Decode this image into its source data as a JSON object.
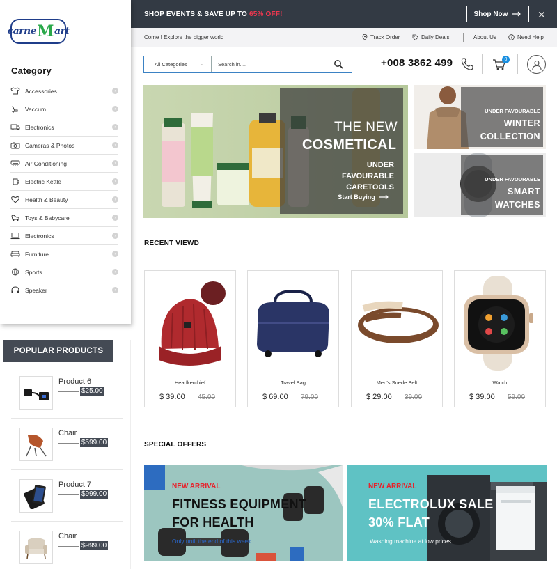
{
  "brand": {
    "logo_text_a": "carne",
    "logo_text_m": "M",
    "logo_text_b": "art"
  },
  "topbar": {
    "promo_text": "SHOP EVENTS & SAVE UP TO ",
    "promo_accent": "65% OFF!",
    "shop_now": "Shop Now"
  },
  "infobar": {
    "welcome": "Come ! Explore the bigger world !",
    "track_order": "Track Order",
    "daily_deals": "Daily Deals",
    "about_us": "About Us",
    "need_help": "Need Help"
  },
  "search": {
    "category": "All Categories",
    "placeholder": "Search in....",
    "phone": "+008 3862 499",
    "cart_count": "0"
  },
  "sidebar": {
    "title": "Category",
    "items": [
      {
        "label": "Accessories",
        "icon": "shirt-icon"
      },
      {
        "label": "Vaccum",
        "icon": "vacuum-icon"
      },
      {
        "label": "Electronics",
        "icon": "truck-icon"
      },
      {
        "label": "Cameras & Photos",
        "icon": "camera-icon"
      },
      {
        "label": "Air Conditioning",
        "icon": "air-conditioner-icon"
      },
      {
        "label": "Electric Kettle",
        "icon": "kettle-icon"
      },
      {
        "label": "Health & Beauty",
        "icon": "heart-icon"
      },
      {
        "label": "Toys & Babycare",
        "icon": "toy-icon"
      },
      {
        "label": "Electronics",
        "icon": "laptop-icon"
      },
      {
        "label": "Furniture",
        "icon": "sofa-icon"
      },
      {
        "label": "Sports",
        "icon": "ball-icon"
      },
      {
        "label": "Speaker",
        "icon": "headphones-icon"
      }
    ]
  },
  "popular": {
    "title": "POPULAR PRODUCTS",
    "items": [
      {
        "name": "Product 6",
        "price": "$25.00"
      },
      {
        "name": "Chair",
        "price": "$599.00"
      },
      {
        "name": "Product 7",
        "price": "$999.00"
      },
      {
        "name": "Chair",
        "price": "$999.00"
      }
    ]
  },
  "hero": {
    "title1": "THE NEW",
    "title2": "COSMETICAL",
    "sub1": "UNDER FAVOURABLE",
    "sub2": "CARETOOLS",
    "button": "Start Buying"
  },
  "side_banners": [
    {
      "small": "UNDER FAVOURABLE",
      "big1": "WINTER",
      "big2": "COLLECTION"
    },
    {
      "small": "UNDER FAVOURABLE",
      "big1": "SMART",
      "big2": "WATCHES"
    }
  ],
  "recent": {
    "title": "RECENT VIEWD",
    "products": [
      {
        "name": "Headkerchief",
        "price": "$ 39.00",
        "old_price": "45.00"
      },
      {
        "name": "Travel Bag",
        "price": "$ 69.00",
        "old_price": "79.00"
      },
      {
        "name": "Men’s  Suede Belt",
        "price": "$ 29.00",
        "old_price": "39.00"
      },
      {
        "name": "Watch",
        "price": "$ 39.00",
        "old_price": "59.00"
      }
    ]
  },
  "special": {
    "title": "SPECIAL OFFERS",
    "offers": [
      {
        "tag": "NEW ARRIVAL",
        "big1": "FITNESS EQUIPMENT",
        "big2": "FOR HEALTH",
        "small": "Only until the end of this week"
      },
      {
        "tag": "NEW ARRIVAL",
        "big1": "ELECTROLUX SALE",
        "big2": "30% FLAT",
        "small": "Washing machine at low prices."
      }
    ]
  },
  "colors": {
    "dark": "#333a44",
    "accent_red": "#f0374f",
    "link_blue": "#3b82c4",
    "badge_blue": "#1a8fe0"
  }
}
